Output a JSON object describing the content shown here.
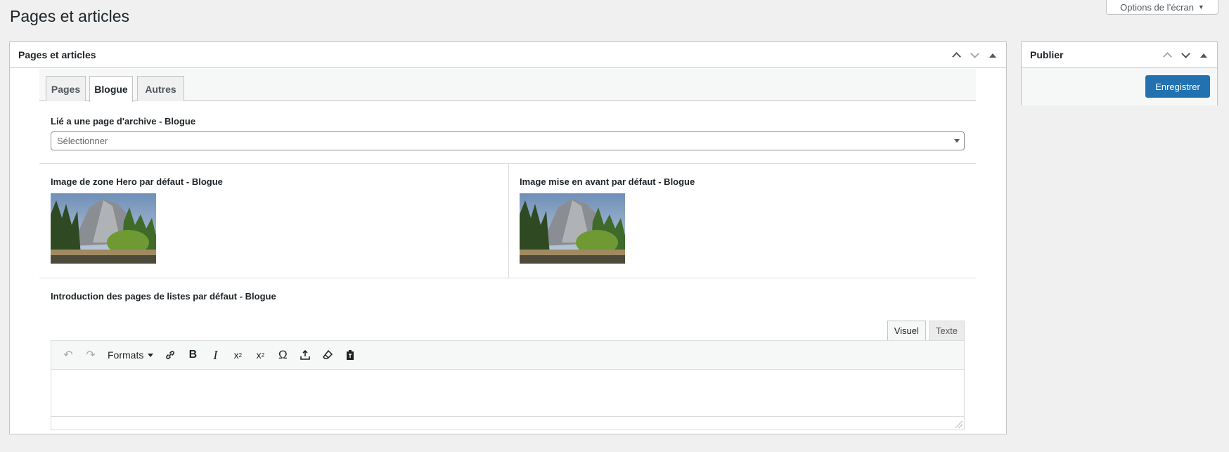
{
  "page": {
    "title": "Pages et articles",
    "screen_options_label": "Options de l’écran"
  },
  "main_box": {
    "title": "Pages et articles",
    "tabs": [
      {
        "label": "Pages",
        "active": false
      },
      {
        "label": "Blogue",
        "active": true
      },
      {
        "label": "Autres",
        "active": false
      }
    ],
    "archive_label": "Lié a une page d'archive - Blogue",
    "archive_select_placeholder": "Sélectionner",
    "hero_image_label": "Image de zone Hero par défaut - Blogue",
    "featured_image_label": "Image mise en avant par défaut - Blogue",
    "intro_label": "Introduction des pages de listes par défaut - Blogue",
    "editor": {
      "tab_visual": "Visuel",
      "tab_text": "Texte",
      "formats_label": "Formats",
      "toolbar_icons": [
        "undo-icon",
        "redo-icon",
        "link-icon",
        "bold-icon",
        "italic-icon",
        "superscript-icon",
        "subscript-icon",
        "omega-icon",
        "upload-icon",
        "eraser-icon",
        "paste-icon"
      ]
    }
  },
  "publish_box": {
    "title": "Publier",
    "save_label": "Enregistrer"
  },
  "colors": {
    "primary": "#2271b1",
    "background": "#f0f0f1",
    "border": "#c3c4c7"
  }
}
